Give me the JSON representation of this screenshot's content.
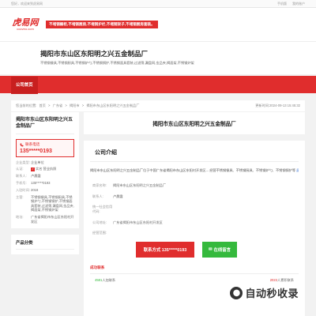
{
  "topbar": {
    "welcome": "您好，欢迎来到虎易网",
    "links": [
      "手机版",
      "我的账户"
    ]
  },
  "brand": {
    "logo_cn": "虎易网",
    "logo_en": "cooveo.com",
    "slogan": "不堵钢橱柜,不堵钢厨房,不堵钢护栏,不堵钢架子,不堵钢厨房套装。"
  },
  "company": {
    "name": "揭阳市东山区东阳明之兴五金制品厂",
    "keywords": "不锈钢餐具,不锈钢厨具,不锈钢炉勺,不锈钢锅铲,不锈钢面具套装,过滤筛,漏盘网,金品夹,揭面架,不锈钢炉架"
  },
  "nav": {
    "home": "公司首页"
  },
  "breadcrumb": {
    "prefix": "您当前的位置:",
    "items": [
      "首页",
      ">",
      "广东省",
      ">",
      "揭阳市",
      ">",
      "揭阳市东山区东阳明之兴五金制品厂"
    ],
    "updated": "更新时间:2024-09-13 15:45:32"
  },
  "sidebar": {
    "title": "揭阳市东山区东阳明之兴五金制品厂",
    "phone_label": "联系电话",
    "phone": "135*****0193",
    "info": [
      {
        "k": "企业类型:",
        "v": "企业单位"
      },
      {
        "k": "认证:",
        "v": "实名  营业执照"
      },
      {
        "k": "联系人:",
        "v": "卢晨霞"
      },
      {
        "k": "手机号:",
        "v": "135*****0193"
      },
      {
        "k": "入驻时间:",
        "v": "2018"
      },
      {
        "k": "主营:",
        "v": "不锈钢餐具,不锈钢厨具,不锈钢炉勺,不锈钢锅铲,不锈钢面具套装,过滤筛,漏盘网,金品夹,揭面架,不锈钢炉架"
      },
      {
        "k": "地址:",
        "v": "广东省揭阳市东山区东阳村开发区"
      }
    ],
    "category_title": "产品分类"
  },
  "main": {
    "title": "揭阳市东山区东阳明之兴五金制品厂",
    "section": "公司介绍",
    "intro": "揭阳市东山区东阳明之兴五金制品厂位于中国广东省揭阳市东山区东阳村开发区... 经营不锈钢餐具、不锈钢厨具、不锈钢炉勺、不锈钢锅铲等",
    "more": "展开",
    "details": [
      {
        "k": "商家名称:",
        "v": "揭阳市东山区东阳明之兴五金制品厂"
      },
      {
        "k": "联系人:",
        "v": "卢晨霞"
      },
      {
        "k": "统一社会信用代码:",
        "v": ""
      },
      {
        "k": "公司地址:",
        "v": "广东省揭阳市东山区东阳村开发区"
      },
      {
        "k": "经营范围:",
        "v": ""
      }
    ],
    "btn_call": "联系方式 135*****0193",
    "btn_wechat": "在线留言",
    "contact_title": "成功联系",
    "stats": [
      {
        "n": "4581",
        "t": "人加联系"
      },
      {
        "n": "2022",
        "t": "人累积联系"
      }
    ]
  },
  "watermark": {
    "text": "自动秒收录"
  }
}
